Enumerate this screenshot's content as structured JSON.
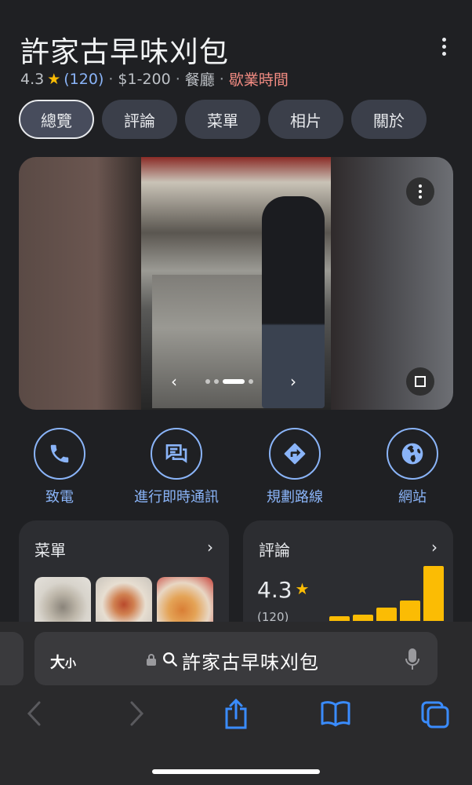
{
  "place": {
    "name": "許家古早味刈包",
    "rating": "4.3",
    "review_count": "(120)",
    "price": "$1-200",
    "category": "餐廳",
    "hours_link": "歇業時間",
    "separator": "·"
  },
  "tabs": [
    {
      "label": "總覽",
      "active": true
    },
    {
      "label": "評論",
      "active": false
    },
    {
      "label": "菜單",
      "active": false
    },
    {
      "label": "相片",
      "active": false
    },
    {
      "label": "關於",
      "active": false
    }
  ],
  "photo": {
    "carousel_index": 3,
    "carousel_total": 5
  },
  "actions": [
    {
      "label": "致電",
      "icon": "phone-icon"
    },
    {
      "label": "進行即時通訊",
      "icon": "chat-icon"
    },
    {
      "label": "規劃路線",
      "icon": "directions-icon"
    },
    {
      "label": "網站",
      "icon": "globe-icon"
    }
  ],
  "cards": {
    "menu": {
      "title": "菜單"
    },
    "reviews": {
      "title": "評論",
      "rating": "4.3",
      "count": "(120)",
      "distribution_fraction": [
        0.08,
        0.11,
        0.24,
        0.37,
        1.0
      ]
    }
  },
  "colors": {
    "accent": "#8ab4f8",
    "star": "#fbbc04",
    "closed": "#f28b82",
    "background": "#1f2023"
  },
  "browser": {
    "text_size": "大",
    "text_size_small": "小",
    "url": "許家古早味刈包"
  }
}
